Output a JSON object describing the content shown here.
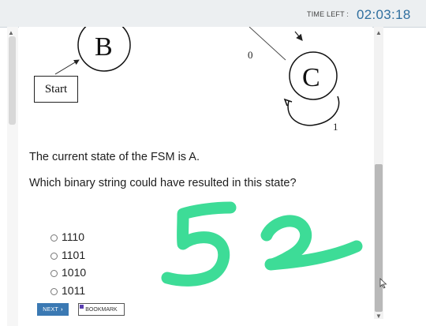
{
  "header": {
    "timer_label": "TIME LEFT :",
    "timer_value": "02:03:18"
  },
  "diagram": {
    "states": [
      "B",
      "C"
    ],
    "start_label": "Start",
    "edge_labels": [
      "0",
      "1"
    ]
  },
  "question": {
    "line1": "The current state of the FSM is A.",
    "line2": "Which binary string could have resulted in this state?"
  },
  "options": [
    "1110",
    "1101",
    "1010",
    "1011"
  ],
  "buttons": {
    "next_label": "NEXT",
    "next_icon": "chevron-right-icon",
    "bookmark_label": "BOOKMARK"
  },
  "annotation": {
    "handwritten_text": "52",
    "color": "#3ddc97"
  },
  "colors": {
    "timer": "#2f6f9f",
    "next_button": "#3b79b3"
  }
}
